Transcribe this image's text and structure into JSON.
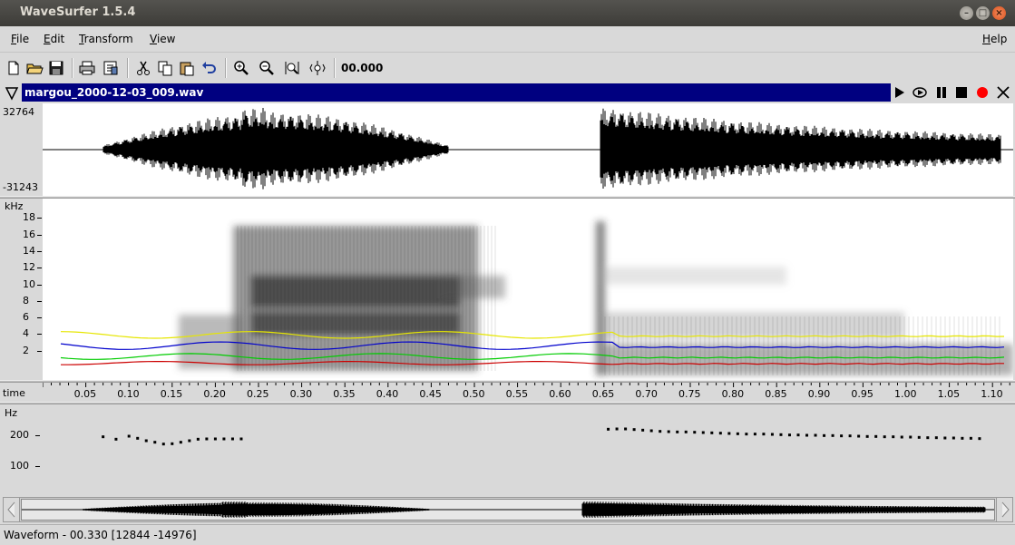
{
  "window": {
    "title": "WaveSurfer 1.5.4",
    "buttons": [
      "minimize",
      "maximize",
      "close"
    ]
  },
  "menubar": {
    "items": [
      "File",
      "Edit",
      "Transform",
      "View"
    ],
    "help": "Help"
  },
  "toolbar": {
    "icons": [
      "new-file-icon",
      "open-folder-icon",
      "save-icon",
      "print-icon",
      "properties-icon",
      "cut-icon",
      "copy-icon",
      "paste-icon",
      "undo-icon",
      "zoom-in-icon",
      "zoom-out-icon",
      "zoom-to-selection-icon",
      "zoom-all-icon"
    ],
    "time": "00.000"
  },
  "sound": {
    "filename": "margou_2000-12-03_009.wav",
    "controls": [
      "play-icon",
      "play-loop-icon",
      "pause-icon",
      "stop-icon",
      "record-icon",
      "close-icon"
    ],
    "record_color": "#ff0000"
  },
  "waveform": {
    "ymax": "32764",
    "ymin": "-31243"
  },
  "spectrogram": {
    "unit": "kHz",
    "ticks": [
      "18",
      "16",
      "14",
      "12",
      "10",
      "8",
      "6",
      "4",
      "2"
    ],
    "formant_colors": {
      "F1": "#cc0000",
      "F2": "#00cc00",
      "F3": "#0000cc",
      "F4": "#e6e600"
    }
  },
  "timeaxis": {
    "label": "time",
    "ticks": [
      "0.05",
      "0.10",
      "0.15",
      "0.20",
      "0.25",
      "0.30",
      "0.35",
      "0.40",
      "0.45",
      "0.50",
      "0.55",
      "0.60",
      "0.65",
      "0.70",
      "0.75",
      "0.80",
      "0.85",
      "0.90",
      "0.95",
      "1.00",
      "1.05",
      "1.10"
    ]
  },
  "pitch": {
    "unit": "Hz",
    "ticks": [
      "200",
      "100"
    ]
  },
  "chart_data": [
    {
      "type": "scatter",
      "title": "",
      "ylabel": "Hz",
      "xlabel": "time",
      "xlim": [
        0.0,
        1.11
      ],
      "ylim": [
        0,
        300
      ],
      "series": [
        {
          "x": [
            0.07,
            0.085,
            0.1,
            0.11,
            0.12,
            0.13,
            0.14,
            0.15,
            0.16,
            0.17,
            0.18,
            0.19,
            0.2,
            0.21,
            0.22,
            0.23
          ],
          "values": [
            196,
            188,
            198,
            191,
            183,
            178,
            172,
            173,
            178,
            183,
            188,
            189,
            189,
            189,
            189,
            189
          ]
        },
        {
          "x": [
            0.655,
            0.665,
            0.675,
            0.685,
            0.695,
            0.705,
            0.715,
            0.725,
            0.735,
            0.745,
            0.755,
            0.765,
            0.775,
            0.785,
            0.795,
            0.805,
            0.815,
            0.825,
            0.835,
            0.845,
            0.855,
            0.865,
            0.875,
            0.885,
            0.895,
            0.905,
            0.915,
            0.925,
            0.935,
            0.945,
            0.955,
            0.965,
            0.975,
            0.985,
            0.995,
            1.005,
            1.015,
            1.025,
            1.035,
            1.045,
            1.055,
            1.065,
            1.075,
            1.085
          ],
          "values": [
            221,
            222,
            222,
            220,
            218,
            216,
            214,
            213,
            212,
            212,
            211,
            210,
            209,
            208,
            207,
            206,
            205,
            205,
            205,
            204,
            203,
            202,
            202,
            201,
            201,
            200,
            200,
            199,
            199,
            198,
            197,
            197,
            196,
            196,
            195,
            195,
            194,
            193,
            193,
            192,
            192,
            191,
            191,
            190
          ]
        }
      ]
    }
  ],
  "status": "Waveform - 00.330 [12844 -14976]"
}
